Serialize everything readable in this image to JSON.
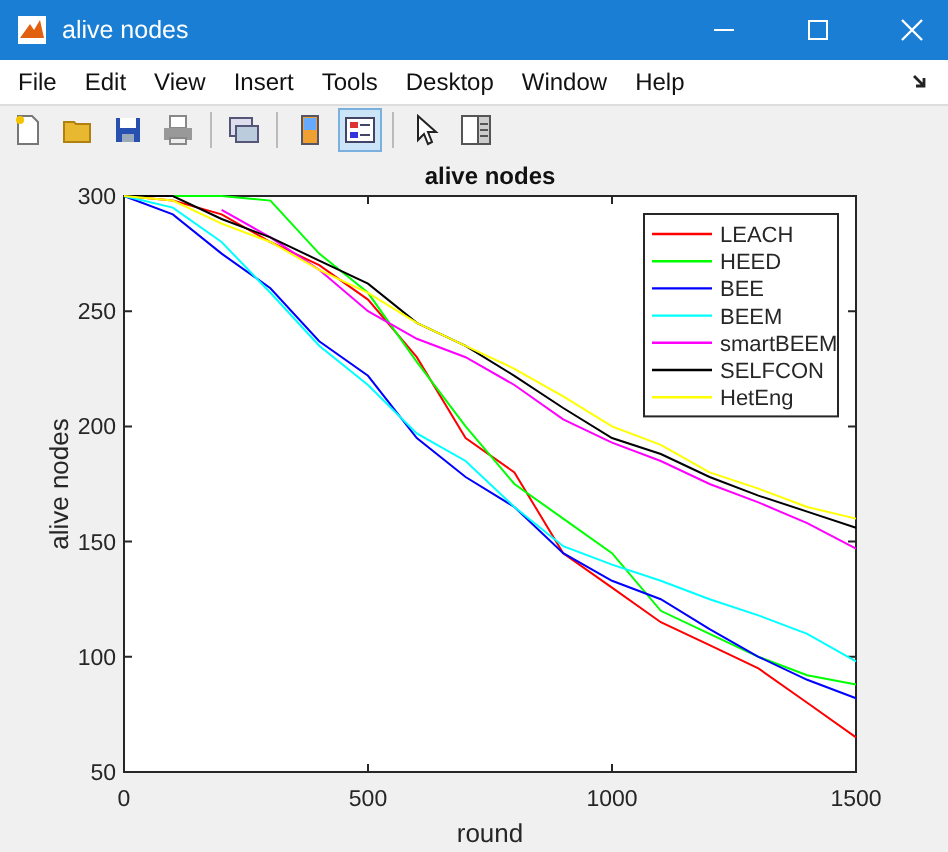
{
  "window": {
    "title": "alive nodes"
  },
  "menu": [
    "File",
    "Edit",
    "View",
    "Insert",
    "Tools",
    "Desktop",
    "Window",
    "Help"
  ],
  "toolbar": [
    {
      "kind": "new",
      "selected": false
    },
    {
      "kind": "open",
      "selected": false
    },
    {
      "kind": "save",
      "selected": false
    },
    {
      "kind": "print",
      "selected": false
    },
    {
      "kind": "separator"
    },
    {
      "kind": "figure",
      "selected": false
    },
    {
      "kind": "separator"
    },
    {
      "kind": "colorbar",
      "selected": false
    },
    {
      "kind": "legend",
      "selected": true
    },
    {
      "kind": "separator"
    },
    {
      "kind": "pointer",
      "selected": false
    },
    {
      "kind": "panel",
      "selected": false
    }
  ],
  "figure": {
    "chart_data": {
      "type": "line",
      "title": "alive nodes",
      "xlabel": "round",
      "ylabel": "alive nodes",
      "x": [
        0,
        100,
        200,
        300,
        400,
        500,
        600,
        700,
        800,
        900,
        1000,
        1100,
        1200,
        1300,
        1400,
        1500
      ],
      "series": [
        {
          "name": "LEACH",
          "color": "#ff0000",
          "values": [
            300,
            298,
            292,
            280,
            270,
            255,
            230,
            195,
            180,
            145,
            130,
            115,
            105,
            95,
            80,
            65
          ]
        },
        {
          "name": "HEED",
          "color": "#00ff00",
          "values": [
            300,
            300,
            300,
            298,
            275,
            258,
            228,
            200,
            175,
            160,
            145,
            120,
            110,
            100,
            92,
            88
          ]
        },
        {
          "name": "BEE",
          "color": "#0000ff",
          "values": [
            300,
            292,
            275,
            260,
            237,
            222,
            195,
            178,
            165,
            145,
            133,
            125,
            112,
            100,
            90,
            82
          ]
        },
        {
          "name": "BEEM",
          "color": "#00ffff",
          "values": [
            300,
            295,
            280,
            258,
            235,
            218,
            197,
            185,
            165,
            148,
            140,
            133,
            125,
            118,
            110,
            98
          ]
        },
        {
          "name": "smartBEEM",
          "color": "#ff00ff",
          "values": [
            null,
            null,
            294,
            282,
            268,
            250,
            238,
            230,
            218,
            203,
            193,
            185,
            175,
            167,
            158,
            147
          ]
        },
        {
          "name": "SELFCON",
          "color": "#000000",
          "values": [
            300,
            300,
            290,
            282,
            272,
            262,
            245,
            235,
            222,
            208,
            195,
            188,
            178,
            170,
            163,
            156
          ]
        },
        {
          "name": "HetEng",
          "color": "#ffff00",
          "values": [
            300,
            298,
            288,
            280,
            268,
            258,
            245,
            235,
            225,
            213,
            200,
            192,
            180,
            173,
            165,
            160
          ]
        }
      ],
      "legend": true,
      "xlim": [
        0,
        1500
      ],
      "ylim": [
        50,
        300
      ],
      "xticks": [
        0,
        500,
        1000,
        1500
      ],
      "yticks": [
        50,
        100,
        150,
        200,
        250,
        300
      ]
    }
  }
}
